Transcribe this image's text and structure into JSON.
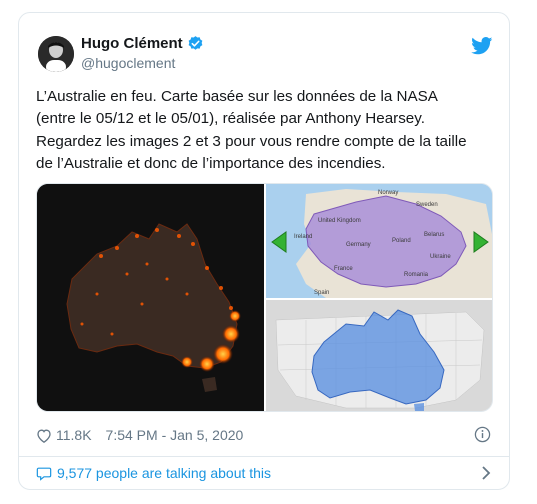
{
  "tweet": {
    "author_name": "Hugo Clément",
    "author_handle": "@hugoclement",
    "text": "L’Australie en feu. Carte basée sur les données de la NASA\n(entre le 05/12 et le 05/01), réalisée par Anthony Hearsey.\nRegardez les images 2 et 3 pour vous rendre compte de la taille\nde l’Australie et donc de l’importance des incendies.",
    "likes": "11.8K",
    "timestamp": "7:54 PM - Jan 5, 2020",
    "talking": "9,577 people are talking about this"
  },
  "media": {
    "europe_map_labels": [
      "Norway",
      "Sweden",
      "United Kingdom",
      "Ireland",
      "Germany",
      "Poland",
      "Belarus",
      "France",
      "Ukraine",
      "Romania",
      "Spain"
    ]
  },
  "colors": {
    "link_blue": "#1da1f2",
    "secondary_text": "#657786",
    "australia_overlay_purple": "#a58ad8",
    "australia_overlay_blue": "#5a8fe0"
  },
  "icons": {
    "verified": "verified-badge-icon",
    "bird": "twitter-bird-icon",
    "heart": "heart-icon",
    "info": "info-icon",
    "bubble": "speech-bubble-icon",
    "chevron": "chevron-right-icon"
  }
}
